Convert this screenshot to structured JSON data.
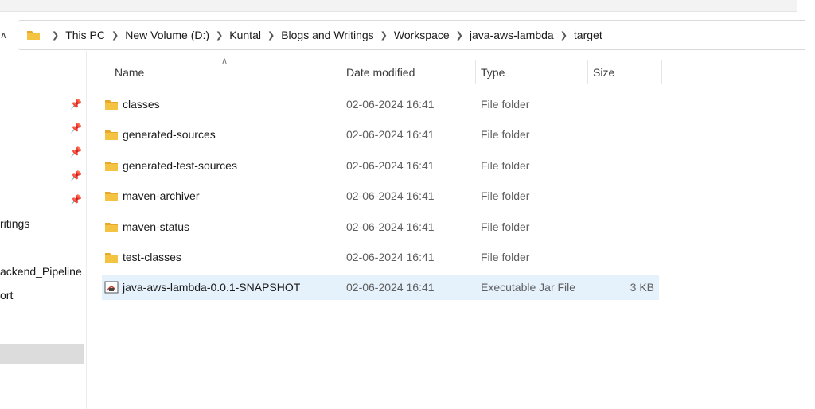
{
  "breadcrumb": [
    "This PC",
    "New Volume (D:)",
    "Kuntal",
    "Blogs and Writings",
    "Workspace",
    "java-aws-lambda",
    "target"
  ],
  "nav": {
    "items": [
      "ritings",
      "ackend_Pipeline",
      "ort"
    ]
  },
  "columns": {
    "name": "Name",
    "date": "Date modified",
    "type": "Type",
    "size": "Size"
  },
  "files": [
    {
      "name": "classes",
      "date": "02-06-2024 16:41",
      "type": "File folder",
      "size": ""
    },
    {
      "name": "generated-sources",
      "date": "02-06-2024 16:41",
      "type": "File folder",
      "size": ""
    },
    {
      "name": "generated-test-sources",
      "date": "02-06-2024 16:41",
      "type": "File folder",
      "size": ""
    },
    {
      "name": "maven-archiver",
      "date": "02-06-2024 16:41",
      "type": "File folder",
      "size": ""
    },
    {
      "name": "maven-status",
      "date": "02-06-2024 16:41",
      "type": "File folder",
      "size": ""
    },
    {
      "name": "test-classes",
      "date": "02-06-2024 16:41",
      "type": "File folder",
      "size": ""
    },
    {
      "name": "java-aws-lambda-0.0.1-SNAPSHOT",
      "date": "02-06-2024 16:41",
      "type": "Executable Jar File",
      "size": "3 KB",
      "icon": "jar-file-icon",
      "selected": true
    }
  ],
  "colors": {
    "folder": "#f5c342",
    "selection": "#e5f1fb",
    "nav_selection": "#dcdcdc"
  }
}
